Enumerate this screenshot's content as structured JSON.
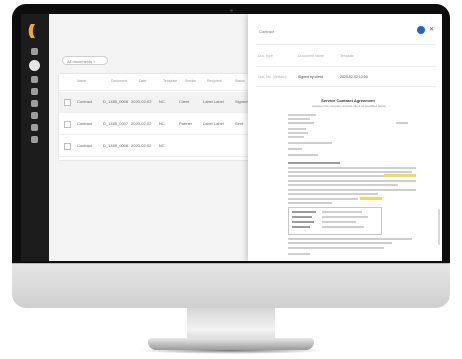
{
  "colors": {
    "accent": "#f2b31a",
    "avatar": "#1e63c6",
    "highlight": "#f3d763"
  },
  "sidebar": {
    "logo": "((",
    "icons": [
      "home-icon",
      "user-icon",
      "document-icon",
      "list-icon",
      "chart-icon",
      "grid-icon",
      "settings-icon",
      "help-icon"
    ]
  },
  "list": {
    "filter": "All documents ×",
    "columns": [
      "Name",
      "Document",
      "Date",
      "Template",
      "Sender",
      "Recipient",
      "Status"
    ],
    "rows": [
      [
        "Contract",
        "D_1485_0006",
        "2020-02-02",
        "NC",
        "Client",
        "Label Label",
        "Signed"
      ],
      [
        "Contract",
        "D_1485_0007",
        "2020-02-02",
        "NC",
        "Partner",
        "Label Label",
        "Sent"
      ],
      [
        "Contract",
        "D_1485_0008",
        "2020-02-02",
        "NC",
        "",
        "",
        ""
      ]
    ]
  },
  "document": {
    "title": "Contract",
    "meta": [
      {
        "label": "Doc. type",
        "value": ""
      },
      {
        "label": "Document name",
        "value": ""
      },
      {
        "label": "Template",
        "value": ""
      }
    ],
    "meta2": [
      {
        "label": "Doc. No. (Version)",
        "value": ""
      },
      {
        "label": "",
        "value": "Signed by client"
      },
      {
        "label": "",
        "value": "2020-02-02 12:00"
      }
    ],
    "letter_title": "Service Contract Agreement",
    "letter_sub": "between the company and the client as specified below"
  }
}
